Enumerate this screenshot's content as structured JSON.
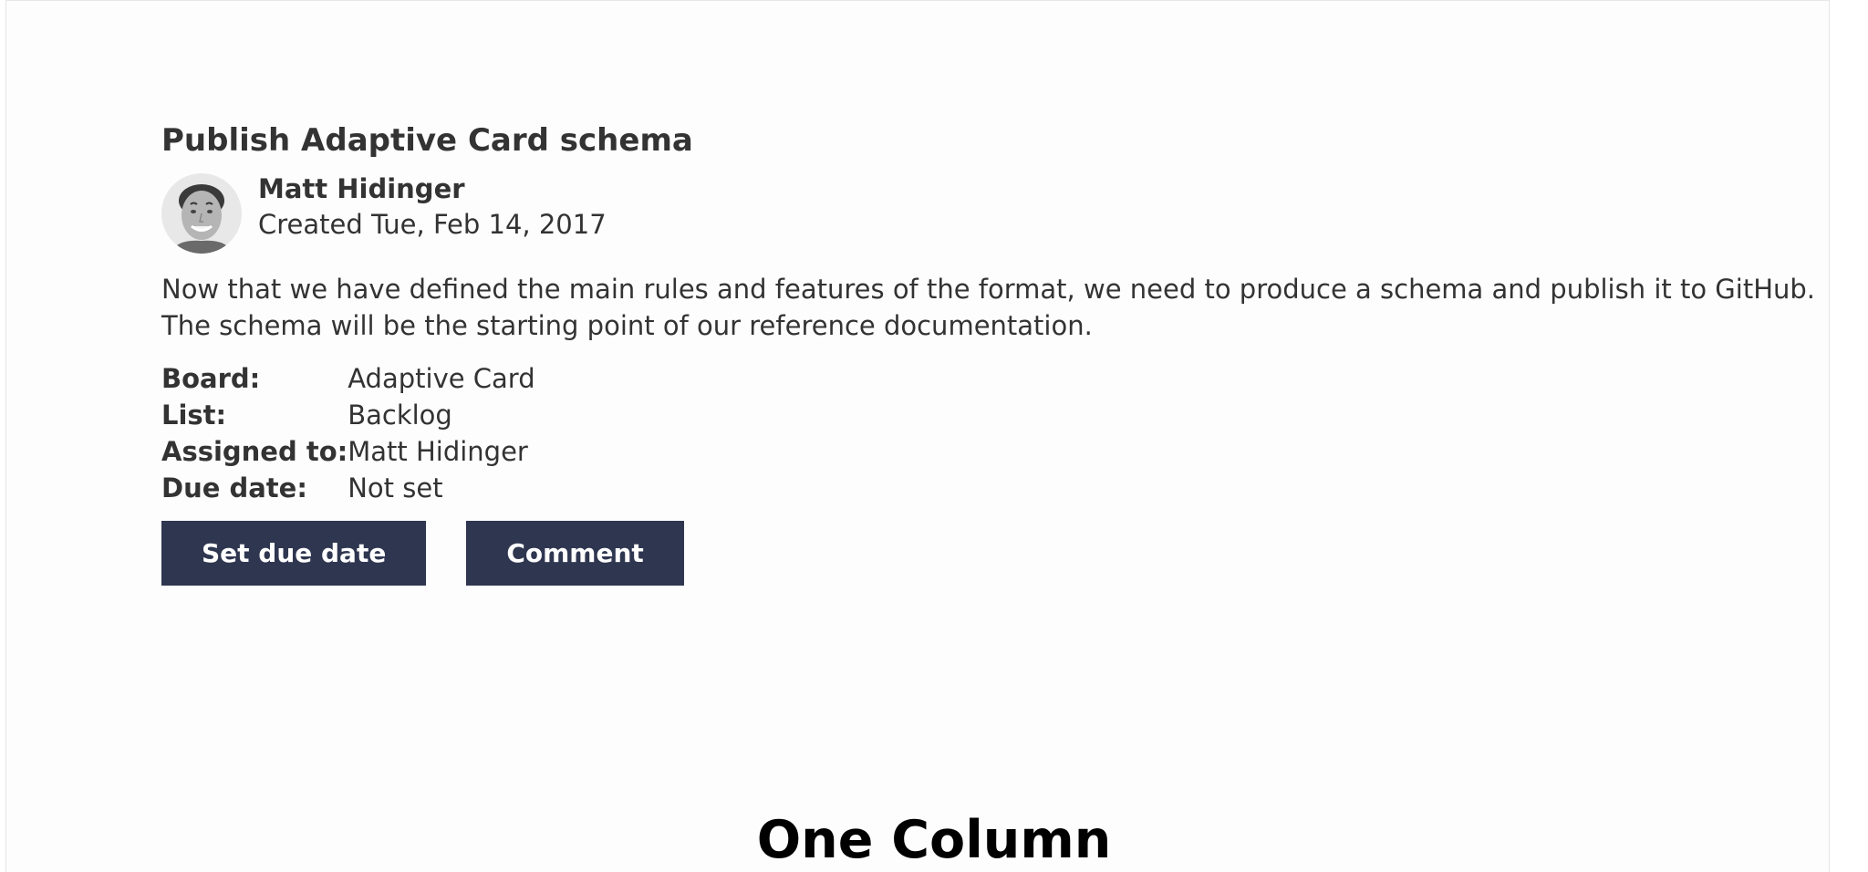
{
  "card": {
    "title": "Publish Adaptive Card schema",
    "author": {
      "name": "Matt Hidinger",
      "created": "Created Tue, Feb 14, 2017",
      "avatar_icon": "person-avatar"
    },
    "description_lines": [
      "Now that we have defined the main rules and features of the format, we need to produce a schema and publish it to GitHub.",
      "The schema will be the starting point of our reference documentation."
    ],
    "facts": [
      {
        "title": "Board:",
        "value": "Adaptive Card"
      },
      {
        "title": "List:",
        "value": "Backlog"
      },
      {
        "title": "Assigned to:",
        "value": "Matt Hidinger"
      },
      {
        "title": "Due date:",
        "value": "Not set"
      }
    ],
    "actions": {
      "set_due_date": "Set due date",
      "comment": "Comment"
    },
    "colors": {
      "button_bg": "#2f3650",
      "text": "#333333"
    }
  },
  "section_heading": "One Column"
}
